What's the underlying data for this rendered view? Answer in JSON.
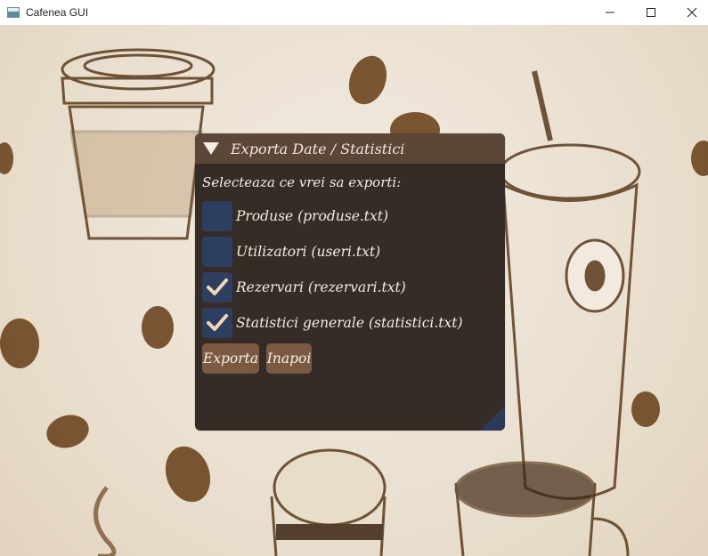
{
  "window": {
    "title": "Cafenea GUI"
  },
  "panel": {
    "title": "Exporta Date / Statistici",
    "prompt": "Selecteaza ce vrei sa exporti:",
    "options": [
      {
        "label": "Produse (produse.txt)",
        "checked": false
      },
      {
        "label": "Utilizatori (useri.txt)",
        "checked": false
      },
      {
        "label": "Rezervari (rezervari.txt)",
        "checked": true
      },
      {
        "label": "Statistici generale (statistici.txt)",
        "checked": true
      }
    ],
    "buttons": {
      "export_label": "Exporta",
      "back_label": "Inapoi"
    }
  },
  "icons": {
    "collapse": "triangle-down-icon",
    "check": "checkmark-icon",
    "app": "window-app-icon"
  },
  "colors": {
    "panel_bg": "#352b27",
    "panel_header": "#5b4637",
    "checkbox_bg": "#2e3e60",
    "button_bg": "#7b5a43",
    "check_color": "#f0d9b5"
  }
}
